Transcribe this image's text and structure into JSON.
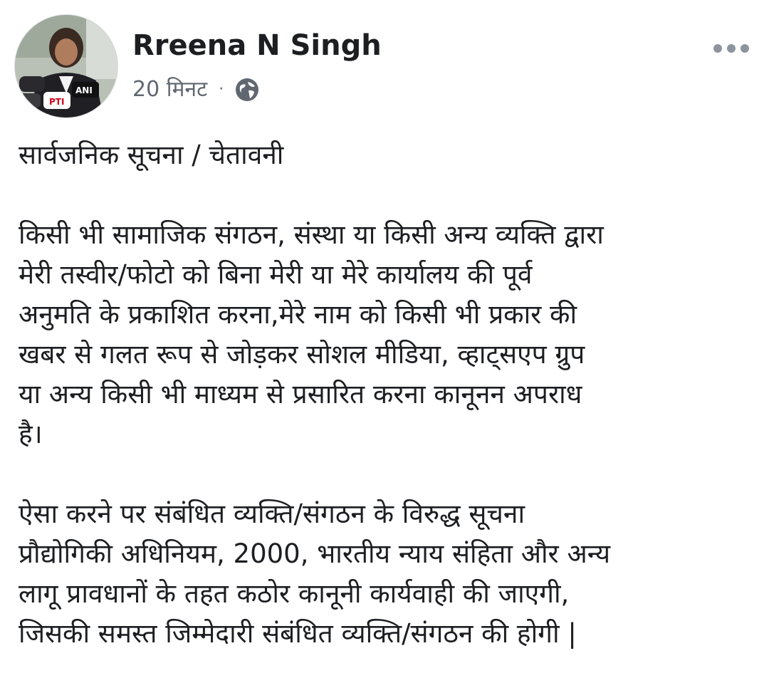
{
  "post": {
    "author": "Rreena N Singh",
    "timestamp": "20 मिनट",
    "separator": "·",
    "privacy_icon": "globe-icon",
    "more_icon": "more-options-icon",
    "title": "सार्वजनिक सूचना / चेतावनी",
    "paragraph1_lines": [
      "किसी भी सामाजिक संगठन, संस्था या किसी अन्य व्यक्ति द्वारा",
      "मेरी तस्वीर/फोटो को बिना मेरी या मेरे कार्यालय की पूर्व",
      "अनुमति के प्रकाशित करना,मेरे नाम को किसी भी प्रकार की",
      "खबर से गलत रूप से जोड़कर सोशल मीडिया, व्हाट्सएप ग्रुप",
      "या अन्य किसी भी माध्यम से प्रसारित करना कानूनन अपराध",
      "है।"
    ],
    "paragraph2_lines": [
      "ऐसा करने पर संबंधित व्यक्ति/संगठन के विरुद्ध सूचना",
      "प्रौद्योगिकी अधिनियम, 2000, भारतीय न्याय संहिता और अन्य",
      "लागू प्रावधानों के तहत कठोर कानूनी कार्यवाही  की जाएगी,",
      "जिसकी समस्त जिम्मेदारी संबंधित व्यक्ति/संगठन की होगी |"
    ],
    "avatar_mic_labels": [
      "ANI",
      "PTI"
    ]
  },
  "colors": {
    "text": "#1c1e21",
    "meta": "#606770",
    "background": "#ffffff"
  }
}
